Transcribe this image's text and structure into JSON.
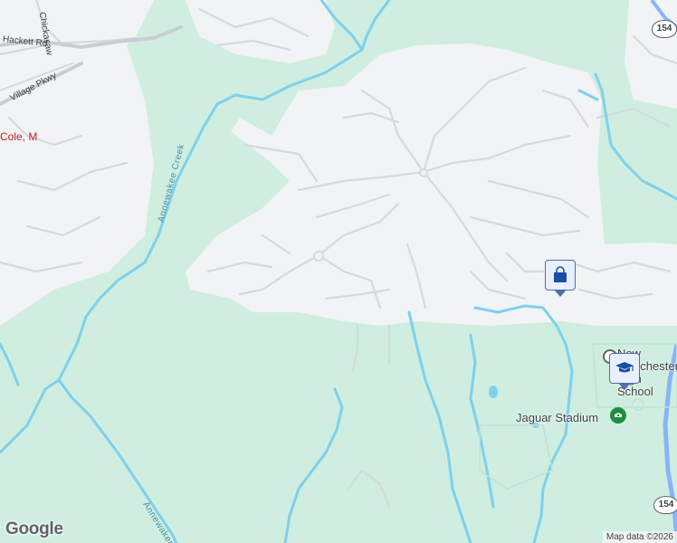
{
  "map": {
    "colors": {
      "park": "#cfeee0",
      "residential": "#f1f3f4",
      "street": "#d4dadf",
      "water": "#7fd0ec",
      "highway": "#8ab4f8",
      "poi_green": "#1e8e3e",
      "poi_blue": "#174ea6",
      "place_red": "#c5221f"
    },
    "labels": {
      "road_1": "Chickasaw",
      "road_2": "Hackett Rd",
      "road_3": "Village Pkwy",
      "place_1": "Cole, M",
      "creek_1": "Annewakee Creek",
      "creek_2": "Annewakee",
      "school": "New Manchester High School",
      "stadium": "Jaguar Stadium"
    },
    "shields": [
      "154",
      "154"
    ],
    "markers": [
      {
        "type": "shopping",
        "icon": "shopping-bag-icon"
      },
      {
        "type": "school",
        "icon": "graduation-cap-icon"
      },
      {
        "type": "stadium",
        "icon": "stadium-icon"
      }
    ],
    "branding": {
      "logo": "Google",
      "attribution": "Map data ©2026"
    }
  }
}
